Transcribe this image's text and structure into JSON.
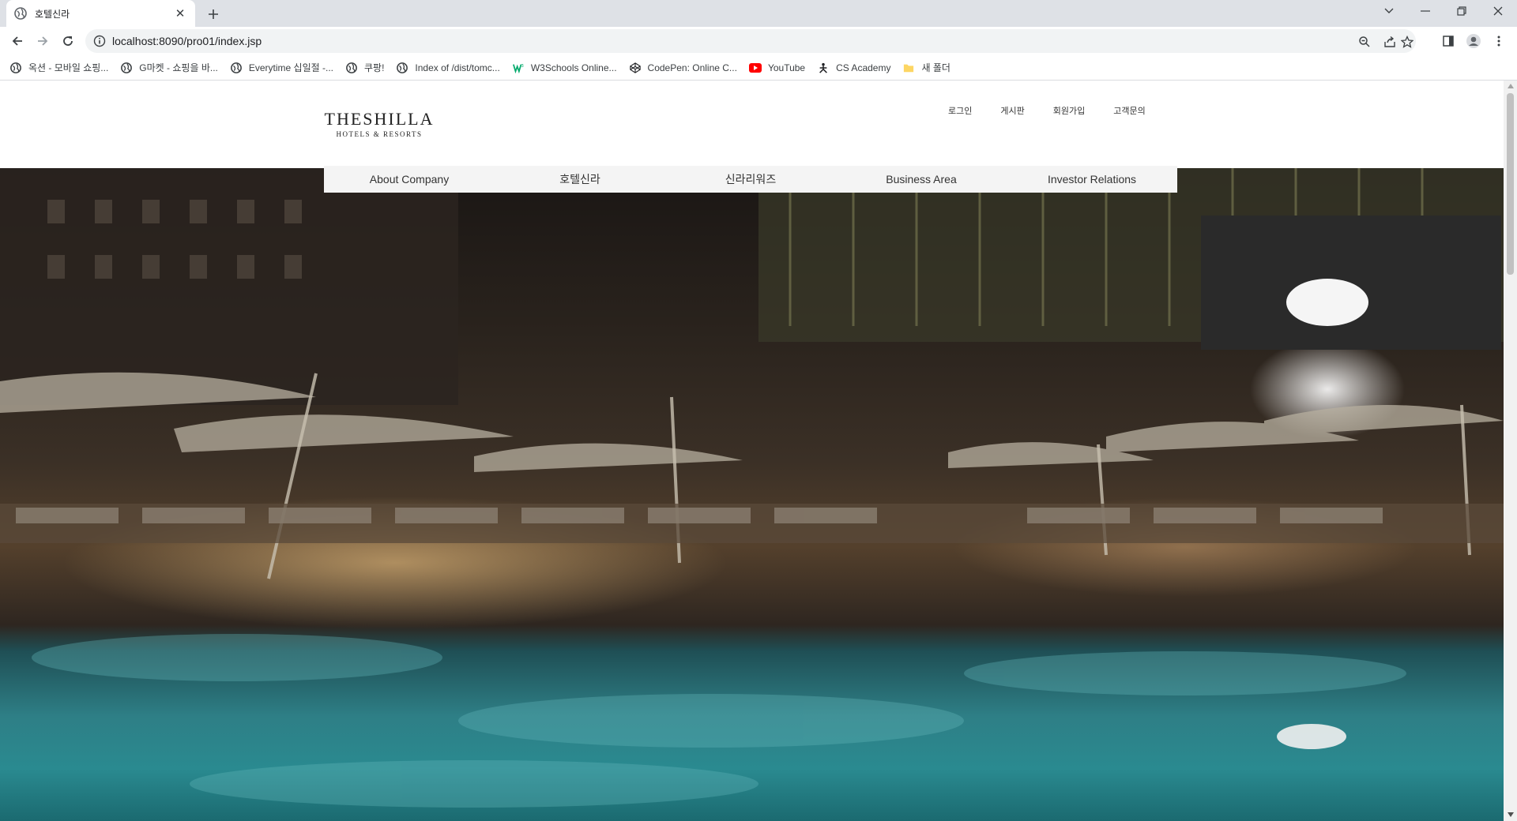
{
  "browser": {
    "tab_title": "호텔신라",
    "url": "localhost:8090/pro01/index.jsp",
    "bookmarks": [
      {
        "label": "옥션 - 모바일 쇼핑...",
        "icon": "globe-icon"
      },
      {
        "label": "G마켓 - 쇼핑을 바...",
        "icon": "globe-icon"
      },
      {
        "label": "Everytime 십일절 -...",
        "icon": "globe-icon"
      },
      {
        "label": "쿠팡!",
        "icon": "globe-icon"
      },
      {
        "label": "Index of /dist/tomc...",
        "icon": "globe-icon"
      },
      {
        "label": "W3Schools Online...",
        "icon": "w3schools-icon"
      },
      {
        "label": "CodePen: Online C...",
        "icon": "codepen-icon"
      },
      {
        "label": "YouTube",
        "icon": "youtube-icon"
      },
      {
        "label": "CS Academy",
        "icon": "cs-academy-icon"
      },
      {
        "label": "새 폴더",
        "icon": "folder-icon"
      }
    ]
  },
  "header": {
    "logo_main": "THESHILLA",
    "logo_sub": "HOTELS & RESORTS",
    "util_links": [
      "로그인",
      "게시판",
      "회원가입",
      "고객문의"
    ]
  },
  "main_nav": [
    "About Company",
    "호텔신라",
    "신라리워즈",
    "Business Area",
    "Investor Relations"
  ],
  "colors": {
    "chrome_bg": "#dee1e6",
    "omnibox_bg": "#f1f3f4",
    "nav_bg": "#f4f4f4",
    "pool": "#2e7f86"
  }
}
